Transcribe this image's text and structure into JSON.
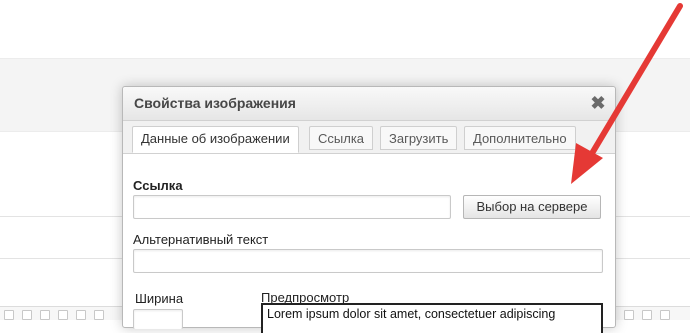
{
  "dialog": {
    "title": "Свойства изображения",
    "close_glyph": "✖",
    "tabs": [
      {
        "label": "Данные об изображении",
        "active": true
      },
      {
        "label": "Ссылка",
        "active": false
      },
      {
        "label": "Загрузить",
        "active": false
      },
      {
        "label": "Дополнительно",
        "active": false
      }
    ],
    "url_label": "Ссылка",
    "url_value": "",
    "browse_button": "Выбор на сервере",
    "alt_label": "Альтернативный текст",
    "alt_value": "",
    "width_label": "Ширина",
    "width_value": "",
    "preview_label": "Предпросмотр",
    "preview_text": "Lorem ipsum dolor sit amet, consectetuer adipiscing"
  },
  "colors": {
    "arrow": "#e53935",
    "title_bar_top": "#f9f9f9",
    "title_bar_bottom": "#e6e6e6"
  }
}
